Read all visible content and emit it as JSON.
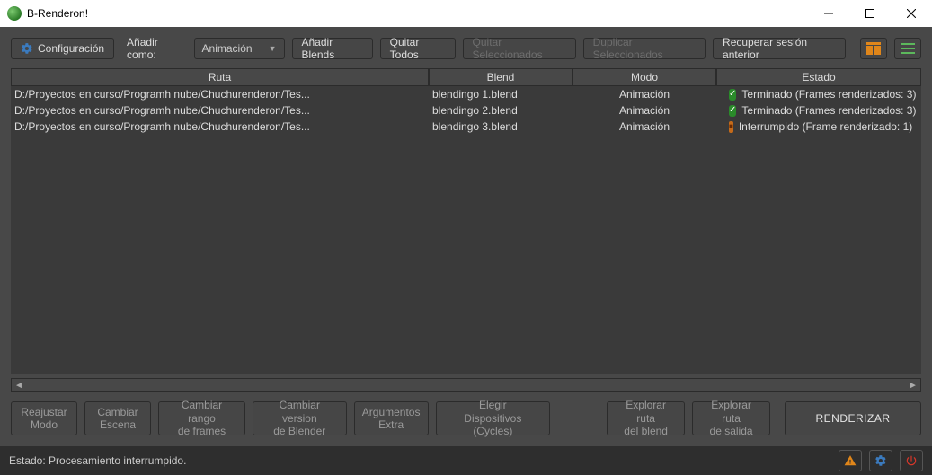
{
  "window": {
    "title": "B-Renderon!"
  },
  "toolbar": {
    "config": "Configuración",
    "add_as_label": "Añadir como:",
    "add_as_value": "Animación",
    "add_blends": "Añadir Blends",
    "remove_all": "Quitar Todos",
    "remove_selected": "Quitar Seleccionados",
    "duplicate_selected": "Duplicar Seleccionados",
    "recover_session": "Recuperar sesión anterior"
  },
  "columns": {
    "ruta": "Ruta",
    "blend": "Blend",
    "modo": "Modo",
    "estado": "Estado"
  },
  "rows": [
    {
      "ruta": "D:/Proyectos en curso/Programh nube/Chuchurenderon/Tes...",
      "blend": "blendingo 1.blend",
      "modo": "Animación",
      "status_icon": "check",
      "status_text": "Terminado  (Frames renderizados: 3)"
    },
    {
      "ruta": "D:/Proyectos en curso/Programh nube/Chuchurenderon/Tes...",
      "blend": "blendingo 2.blend",
      "modo": "Animación",
      "status_icon": "check",
      "status_text": "Terminado  (Frames renderizados: 3)"
    },
    {
      "ruta": "D:/Proyectos en curso/Programh nube/Chuchurenderon/Tes...",
      "blend": "blendingo 3.blend",
      "modo": "Animación",
      "status_icon": "stop",
      "status_text": "Interrumpido  (Frame renderizado: 1)"
    }
  ],
  "bottom": {
    "reajustar_modo": "Reajustar\nModo",
    "cambiar_escena": "Cambiar\nEscena",
    "cambiar_rango": "Cambiar rango\nde frames",
    "cambiar_version": "Cambiar version\nde Blender",
    "argumentos_extra": "Argumentos\nExtra",
    "elegir_dispositivos": "Elegir\nDispositivos (Cycles)",
    "explorar_blend": "Explorar ruta\ndel blend",
    "explorar_salida": "Explorar ruta\nde salida",
    "renderizar": "RENDERIZAR"
  },
  "status": {
    "text": "Estado: Procesamiento interrumpido."
  }
}
